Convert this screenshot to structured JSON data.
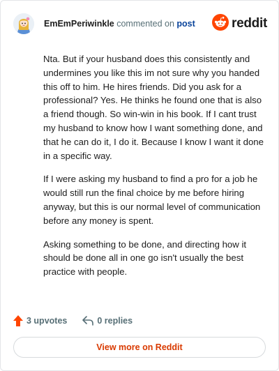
{
  "header": {
    "username": "EmEmPeriwinkle",
    "commented_text": "commented on",
    "post_link": "post",
    "brand_name": "reddit"
  },
  "comment": {
    "paragraphs": [
      "Nta. But if your husband does this consistently and undermines you like this im not sure why you handed this off to him. He hires friends. Did you ask for a professional? Yes. He thinks he found one that is also a friend though. So win-win in his book. If I cant trust my husband to know how I want something done, and that he can do it, I do it. Because I know I want it done in a specific way.",
      "If I were asking my husband to find a pro for a job he would still run the final choice by me before hiring anyway, but this is our normal level of communication before any money is spent.",
      "Asking something to be done, and directing how it should be done all in one go isn't usually the best practice with people."
    ]
  },
  "actions": {
    "upvotes_label": "3 upvotes",
    "replies_label": "0 replies"
  },
  "footer": {
    "view_more_label": "View more on Reddit"
  },
  "colors": {
    "brand_orange": "#ff4500",
    "upvote_orange": "#ff4500",
    "link_blue": "#0a449b",
    "view_more_text": "#d93a00",
    "muted_text": "#576f76"
  },
  "icons": {
    "avatar": "avatar-icon",
    "brand": "reddit-logo-icon",
    "upvote": "upvote-arrow-icon",
    "reply": "reply-arrow-icon"
  }
}
